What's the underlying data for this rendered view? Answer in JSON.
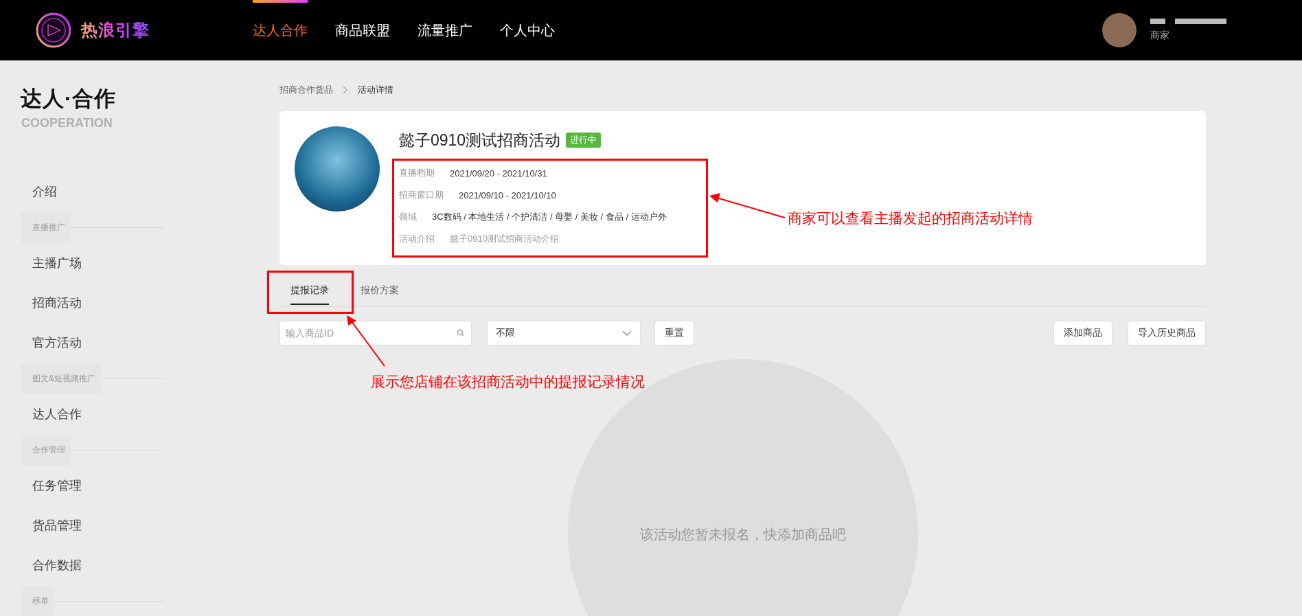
{
  "header": {
    "logo_text": "热浪引擎",
    "nav": [
      {
        "label": "达人合作",
        "selected": true
      },
      {
        "label": "商品联盟",
        "selected": false
      },
      {
        "label": "流量推广",
        "selected": false
      },
      {
        "label": "个人中心",
        "selected": false
      }
    ],
    "user": {
      "role": "商家"
    }
  },
  "sidebar": {
    "title": "达人·合作",
    "subtitle": "COOPERATION",
    "items": [
      {
        "kind": "item",
        "label": "介绍"
      },
      {
        "kind": "group",
        "label": "直播推广"
      },
      {
        "kind": "item",
        "label": "主播广场"
      },
      {
        "kind": "item",
        "label": "招商活动"
      },
      {
        "kind": "item",
        "label": "官方活动"
      },
      {
        "kind": "group",
        "label": "图文&短视频推广"
      },
      {
        "kind": "item",
        "label": "达人合作"
      },
      {
        "kind": "group",
        "label": "合作管理"
      },
      {
        "kind": "item",
        "label": "任务管理"
      },
      {
        "kind": "item",
        "label": "货品管理"
      },
      {
        "kind": "item",
        "label": "合作数据"
      },
      {
        "kind": "group",
        "label": "榜单"
      }
    ]
  },
  "breadcrumb": [
    "招商合作货品",
    "活动详情"
  ],
  "activity": {
    "title": "懿子0910测试招商活动",
    "status": "进行中",
    "info": [
      {
        "label": "直播档期",
        "value": "2021/09/20 - 2021/10/31",
        "muted": false
      },
      {
        "label": "招商窗口期",
        "value": "2021/09/10 - 2021/10/10",
        "muted": false
      },
      {
        "label": "领域",
        "value": "3C数码 / 本地生活 / 个护清洁 / 母婴 / 美妆 / 食品 / 运动户外",
        "muted": false
      },
      {
        "label": "活动介绍",
        "value": "懿子0910测试招商活动介绍",
        "muted": true
      }
    ]
  },
  "tabs": [
    {
      "label": "提报记录",
      "selected": true
    },
    {
      "label": "报价方案",
      "selected": false
    }
  ],
  "toolbar": {
    "search": {
      "placeholder": "输入商品ID"
    },
    "filter": {
      "value": "不限"
    },
    "reset_button": "重置",
    "actions": [
      "添加商品",
      "导入历史商品"
    ]
  },
  "empty_message": "该活动您暂未报名，快添加商品吧",
  "annotations": [
    {
      "text": "商家可以查看主播发起的招商活动详情"
    },
    {
      "text": "展示您店铺在该招商活动中的提报记录情况"
    }
  ]
}
